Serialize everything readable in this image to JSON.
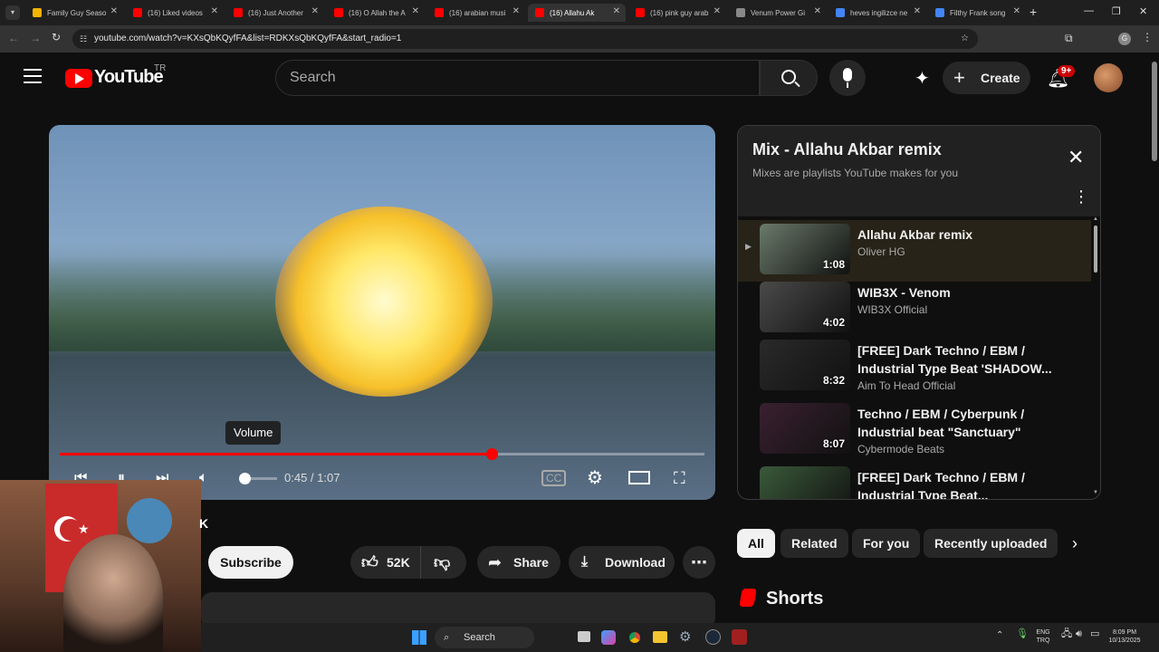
{
  "browser": {
    "tabs": [
      {
        "label": "Family Guy Seaso",
        "color": "#f4b400"
      },
      {
        "label": "(16) Liked videos",
        "color": "#ff0000"
      },
      {
        "label": "(16) Just Another",
        "color": "#ff0000"
      },
      {
        "label": "(16) O Allah the A",
        "color": "#ff0000"
      },
      {
        "label": "(16) arabian musi",
        "color": "#ff0000"
      },
      {
        "label": "(16) Allahu Ak",
        "color": "#ff0000",
        "active": true
      },
      {
        "label": "(16) pink guy arab",
        "color": "#ff0000"
      },
      {
        "label": "Venum Power Gi",
        "color": "#888888"
      },
      {
        "label": "heves ingilizce ne",
        "color": "#4285f4"
      },
      {
        "label": "Filthy Frank song",
        "color": "#4285f4"
      }
    ],
    "url": "youtube.com/watch?v=KXsQbKQyfFA&list=RDKXsQbKQyfFA&start_radio=1",
    "new_tab": "+",
    "tab_close": "✕",
    "minimize": "—",
    "restore": "❐",
    "close": "✕"
  },
  "header": {
    "logo_text": "YouTube",
    "country": "TR",
    "search_placeholder": "Search",
    "create_label": "Create",
    "notif_count": "9+"
  },
  "player": {
    "tooltip": "Volume",
    "time_current": "0:45",
    "time_total": "1:07",
    "time_display": "0:45 / 1:07",
    "progress_fraction": 0.67,
    "volume_fraction": 0.1
  },
  "actions": {
    "subscribe": "Subscribe",
    "likes": "52K",
    "share": "Share",
    "download": "Download",
    "more": "⋯",
    "channel_fragment": "K"
  },
  "mix": {
    "title": "Mix - Allahu Akbar remix",
    "subtitle": "Mixes are playlists YouTube makes for you",
    "items": [
      {
        "title": "Allahu Akbar remix",
        "channel": "Oliver HG",
        "duration": "1:08",
        "current": true,
        "thumb": "#6a7a6a"
      },
      {
        "title": "WIB3X - Venom",
        "channel": "WIB3X Official",
        "duration": "4:02",
        "thumb": "#4a4a4a"
      },
      {
        "title": "[FREE] Dark Techno / EBM / Industrial Type Beat 'SHADOW...",
        "channel": "Aim To Head Official",
        "duration": "8:32",
        "thumb": "#2a2a2a"
      },
      {
        "title": "Techno / EBM / Cyberpunk / Industrial beat \"Sanctuary\"",
        "channel": "Cybermode Beats",
        "duration": "8:07",
        "thumb": "#3a2030"
      },
      {
        "title": "[FREE] Dark Techno / EBM / Industrial Type Beat...",
        "channel": "",
        "duration": "",
        "thumb": "#3a5a3a"
      }
    ]
  },
  "chips": [
    "All",
    "Related",
    "For you",
    "Recently uploaded"
  ],
  "shorts_title": "Shorts",
  "taskbar": {
    "search": "Search",
    "lang_top": "ENG",
    "lang_bottom": "TRQ",
    "time": "8:09 PM",
    "date": "10/13/2025"
  }
}
